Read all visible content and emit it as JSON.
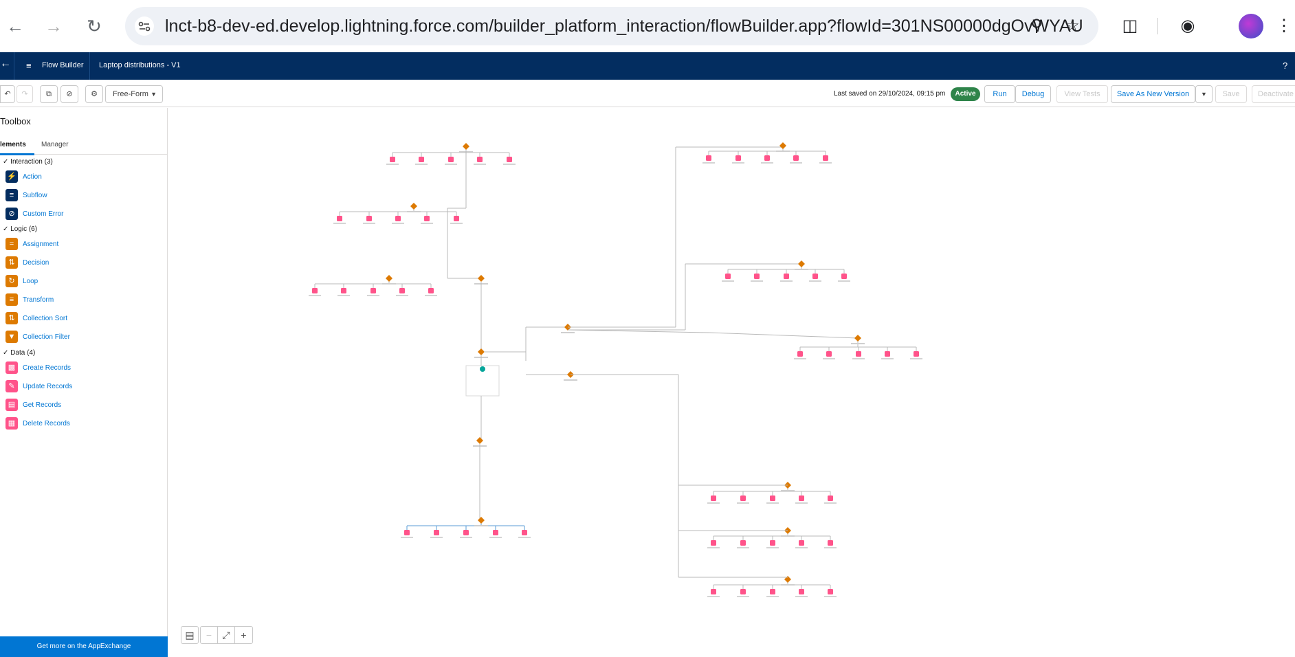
{
  "browser": {
    "url": "lnct-b8-dev-ed.develop.lightning.force.com/builder_platform_interaction/flowBuilder.app?flowId=301NS00000dgOvWYAU"
  },
  "header": {
    "app_name": "Flow Builder",
    "flow_name": "Laptop distributions - V1",
    "help": "?"
  },
  "toolbar": {
    "canvas_mode": "Free-Form",
    "last_saved": "Last saved on 29/10/2024, 09:15 pm",
    "status": "Active",
    "run": "Run",
    "debug": "Debug",
    "view_tests": "View Tests",
    "save_as_new_version": "Save As New Version",
    "save": "Save",
    "deactivate": "Deactivate"
  },
  "toolbox": {
    "title": "Toolbox",
    "tabs": [
      "lements",
      "Manager"
    ],
    "groups": [
      {
        "label": "Interaction (3)",
        "items": [
          {
            "label": "Action",
            "color": "#032d60",
            "icon": "lightning-icon"
          },
          {
            "label": "Subflow",
            "color": "#032d60",
            "icon": "flow-icon"
          },
          {
            "label": "Custom Error",
            "color": "#032d60",
            "icon": "ban-icon"
          }
        ]
      },
      {
        "label": "Logic (6)",
        "items": [
          {
            "label": "Assignment",
            "color": "#dd7a01",
            "icon": "equals-icon"
          },
          {
            "label": "Decision",
            "color": "#dd7a01",
            "icon": "decision-icon"
          },
          {
            "label": "Loop",
            "color": "#dd7a01",
            "icon": "loop-icon"
          },
          {
            "label": "Transform",
            "color": "#dd7a01",
            "icon": "transform-icon"
          },
          {
            "label": "Collection Sort",
            "color": "#dd7a01",
            "icon": "sort-icon"
          },
          {
            "label": "Collection Filter",
            "color": "#dd7a01",
            "icon": "filter-icon"
          }
        ]
      },
      {
        "label": "Data (4)",
        "items": [
          {
            "label": "Create Records",
            "color": "#ff538a",
            "icon": "record-create-icon"
          },
          {
            "label": "Update Records",
            "color": "#ff538a",
            "icon": "record-update-icon"
          },
          {
            "label": "Get Records",
            "color": "#ff538a",
            "icon": "record-lookup-icon"
          },
          {
            "label": "Delete Records",
            "color": "#ff538a",
            "icon": "record-delete-icon"
          }
        ]
      }
    ],
    "appexchange": "Get more on the AppExchange"
  }
}
